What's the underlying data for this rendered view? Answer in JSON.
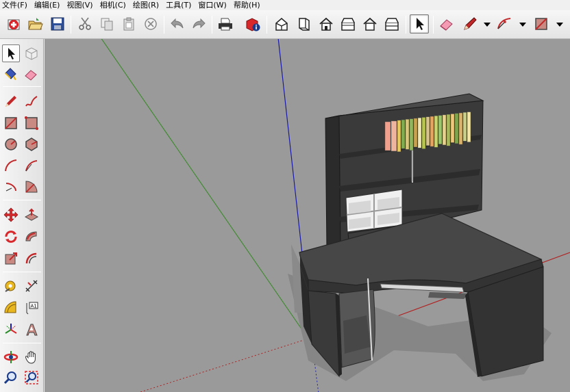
{
  "menu": [
    "文件(F)",
    "编辑(E)",
    "视图(V)",
    "相机(C)",
    "绘图(R)",
    "工具(T)",
    "窗口(W)",
    "帮助(H)"
  ],
  "toolbar_icons": [
    "new-file-icon",
    "open-folder-icon",
    "save-icon",
    "cut-icon",
    "copy-icon",
    "paste-icon",
    "erase-delete-icon",
    "undo-icon",
    "redo-icon",
    "print-icon",
    "model-info-icon",
    "iso-view-icon",
    "top-view-icon",
    "front-view-icon",
    "right-view-icon",
    "back-view-icon",
    "left-view-icon",
    "select-arrow-icon",
    "eraser-icon",
    "pencil-line-icon",
    "arc-icon",
    "rectangle-icon"
  ],
  "left_tools": [
    [
      "select-arrow-icon",
      "component-icon"
    ],
    [
      "paint-bucket-icon",
      "eraser-icon"
    ],
    [
      "line-pencil-icon",
      "freehand-icon"
    ],
    [
      "rectangle-icon",
      "rotated-rectangle-icon"
    ],
    [
      "circle-icon",
      "polygon-icon"
    ],
    [
      "arc-icon",
      "two-point-arc-icon"
    ],
    [
      "three-point-arc-icon",
      "pie-icon"
    ],
    [
      "move-icon",
      "push-pull-icon"
    ],
    [
      "rotate-icon",
      "follow-me-icon"
    ],
    [
      "scale-icon",
      "offset-icon"
    ],
    [
      "tape-measure-icon",
      "dimension-icon"
    ],
    [
      "protractor-icon",
      "text-label-icon"
    ],
    [
      "axes-icon",
      "3d-text-icon"
    ],
    [
      "orbit-icon",
      "pan-hand-icon"
    ],
    [
      "zoom-icon",
      "zoom-window-icon"
    ]
  ],
  "text_tool_label": "A1",
  "colors": {
    "viewport_bg": "#9a9a9a",
    "green_axis": "#3a8a2a",
    "blue_axis": "#1a1aa8",
    "red_axis": "#b02020",
    "desk": "#3c3c3c",
    "desk_top": "#474747",
    "desk_edge": "#262626"
  },
  "book_colors": [
    "#f0a08c",
    "#efb49e",
    "#e8c95a",
    "#7fae4b",
    "#d8c87a",
    "#90b85a",
    "#c9a24a",
    "#f1e9b8",
    "#b8c74a",
    "#d7c38a",
    "#e7a35d",
    "#c8d36a",
    "#9cc66a",
    "#e9d28c",
    "#a8b957",
    "#f0c878",
    "#7ea64a",
    "#dcb36b",
    "#c9cf87",
    "#f3e4a2"
  ]
}
